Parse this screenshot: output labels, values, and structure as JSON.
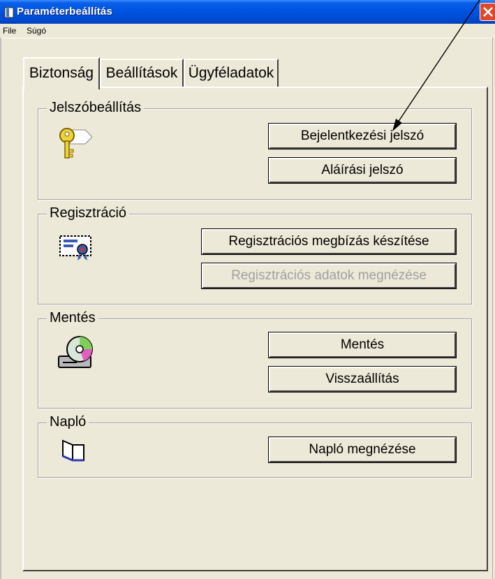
{
  "window": {
    "title": "Paraméterbeállítás"
  },
  "menu": {
    "items": [
      {
        "label": "File"
      },
      {
        "label": "Súgó"
      }
    ]
  },
  "tabs": [
    {
      "label": "Biztonság",
      "active": true
    },
    {
      "label": "Beállítások",
      "active": false
    },
    {
      "label": "Ügyféladatok",
      "active": false
    }
  ],
  "groups": {
    "password": {
      "label": "Jelszóbeállítás",
      "icon": "key-icon",
      "buttons": {
        "login": "Bejelentkezési jelszó",
        "signature": "Aláírási jelszó"
      }
    },
    "registration": {
      "label": "Regisztráció",
      "icon": "certificate-icon",
      "buttons": {
        "create": "Regisztrációs megbízás készítése",
        "view": "Regisztrációs adatok megnézése"
      }
    },
    "backup": {
      "label": "Mentés",
      "icon": "cd-drive-icon",
      "buttons": {
        "save": "Mentés",
        "restore": "Visszaállítás"
      }
    },
    "log": {
      "label": "Napló",
      "icon": "book-icon",
      "buttons": {
        "view": "Napló megnézése"
      }
    }
  },
  "colors": {
    "window_bg": "#ECE9D8",
    "titlebar": "#0054E3",
    "close": "#E0482A",
    "disabled_text": "#A0A0A0"
  }
}
